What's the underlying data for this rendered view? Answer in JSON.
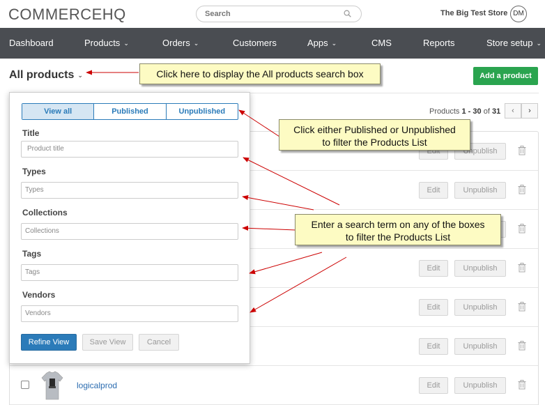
{
  "header": {
    "logo": "COMMERCEHQ",
    "search_placeholder": "Search",
    "store_name": "The Big Test Store",
    "avatar_initials": "DM"
  },
  "nav": {
    "items": [
      {
        "label": "Dashboard",
        "dropdown": false
      },
      {
        "label": "Products",
        "dropdown": true
      },
      {
        "label": "Orders",
        "dropdown": true
      },
      {
        "label": "Customers",
        "dropdown": false
      },
      {
        "label": "Apps",
        "dropdown": true
      },
      {
        "label": "CMS",
        "dropdown": false
      },
      {
        "label": "Reports",
        "dropdown": false
      },
      {
        "label": "Store setup",
        "dropdown": true
      }
    ]
  },
  "page": {
    "title": "All products",
    "add_button": "Add a product"
  },
  "pagination": {
    "prefix": "Products",
    "range_start": "1",
    "range_sep": " - ",
    "range_end": "30",
    "of": "of",
    "total": "31"
  },
  "filter_panel": {
    "segments": [
      "View all",
      "Published",
      "Unpublished"
    ],
    "active_segment": "View all",
    "fields": [
      {
        "label": "Title",
        "placeholder": "Product title"
      },
      {
        "label": "Types",
        "placeholder": "Types"
      },
      {
        "label": "Collections",
        "placeholder": "Collections"
      },
      {
        "label": "Tags",
        "placeholder": "Tags"
      },
      {
        "label": "Vendors",
        "placeholder": "Vendors"
      }
    ],
    "refine_button": "Refine View",
    "save_button": "Save View",
    "cancel_button": "Cancel"
  },
  "product_rows": {
    "edit_label": "Edit",
    "unpublish_label": "Unpublish",
    "last_product_name": "logicalprod"
  },
  "callouts": {
    "search_box": "Click here to display the All products search box",
    "published_line1": "Click either Published or Unpublished",
    "published_line2": "to filter the Products List",
    "search_term_line1": "Enter a search term on any of the boxes",
    "search_term_line2": "to filter the Products List"
  },
  "colors": {
    "nav_bg": "#4a4d52",
    "add_button": "#2aa44f",
    "primary_blue": "#2b7bb9",
    "callout_bg": "#fdfbc3",
    "arrow": "#cc0000"
  }
}
